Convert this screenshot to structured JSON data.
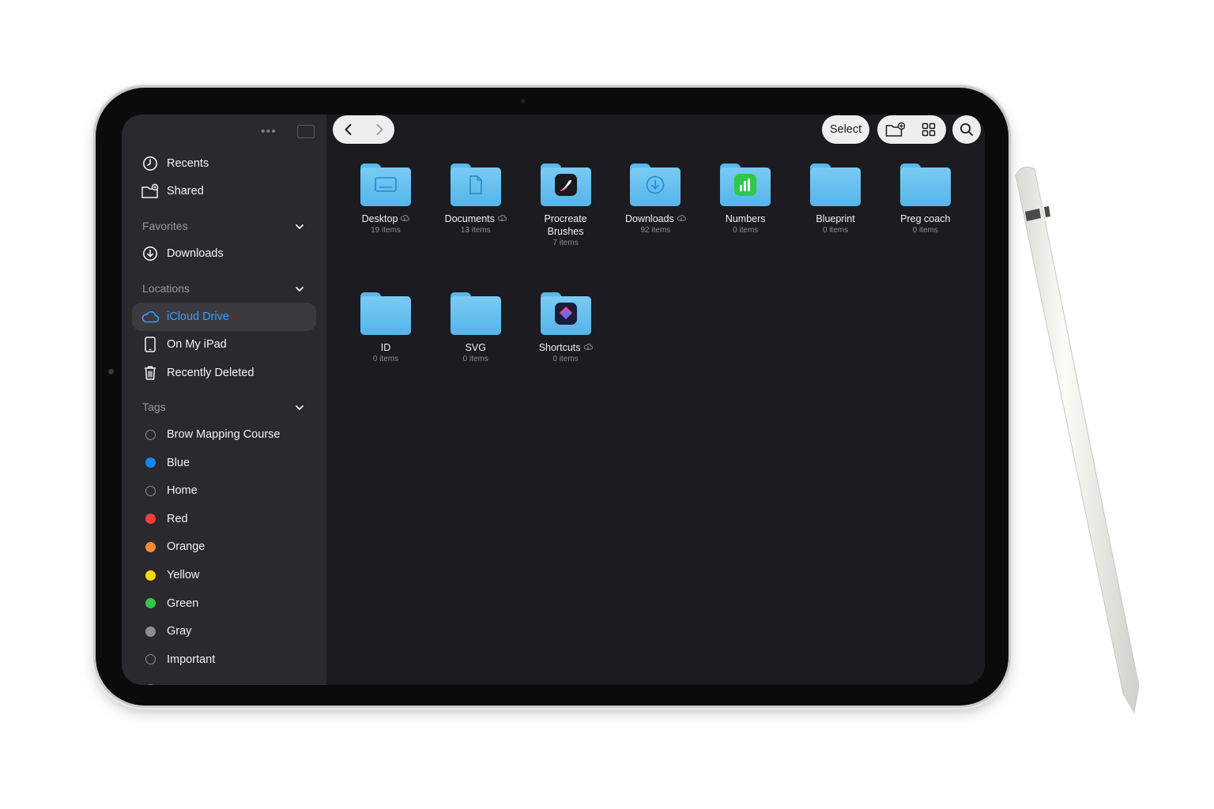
{
  "sidebar": {
    "top_items": [
      {
        "label": "Recents",
        "icon": "clock-icon"
      },
      {
        "label": "Shared",
        "icon": "shared-folder-icon"
      }
    ],
    "favorites": {
      "title": "Favorites",
      "items": [
        {
          "label": "Downloads",
          "icon": "download-circle-icon"
        }
      ]
    },
    "locations": {
      "title": "Locations",
      "items": [
        {
          "label": "iCloud Drive",
          "icon": "cloud-icon",
          "selected": true
        },
        {
          "label": "On My iPad",
          "icon": "ipad-icon"
        },
        {
          "label": "Recently Deleted",
          "icon": "trash-icon"
        }
      ]
    },
    "tags": {
      "title": "Tags",
      "items": [
        {
          "label": "Brow Mapping Course",
          "color": "none"
        },
        {
          "label": "Blue",
          "color": "#1a84ff"
        },
        {
          "label": "Home",
          "color": "none"
        },
        {
          "label": "Red",
          "color": "#ff3b3b"
        },
        {
          "label": "Orange",
          "color": "#ff8a2b"
        },
        {
          "label": "Yellow",
          "color": "#ffd60a"
        },
        {
          "label": "Green",
          "color": "#30c84b"
        },
        {
          "label": "Gray",
          "color": "#8e8e93"
        },
        {
          "label": "Important",
          "color": "none"
        }
      ]
    }
  },
  "toolbar": {
    "select_label": "Select"
  },
  "folders": [
    {
      "name": "Desktop",
      "count": "19 items",
      "cloud": true,
      "icon": "desktop-icon"
    },
    {
      "name": "Documents",
      "count": "13 items",
      "cloud": true,
      "icon": "document-icon"
    },
    {
      "name": "Procreate Brushes",
      "count": "7 items",
      "cloud": false,
      "icon": "procreate-app-icon"
    },
    {
      "name": "Downloads",
      "count": "92 items",
      "cloud": true,
      "icon": "download-circle-icon"
    },
    {
      "name": "Numbers",
      "count": "0 items",
      "cloud": false,
      "icon": "numbers-app-icon"
    },
    {
      "name": "Blueprint",
      "count": "0 items",
      "cloud": false,
      "icon": "none"
    },
    {
      "name": "Preg coach",
      "count": "0 items",
      "cloud": false,
      "icon": "none"
    },
    {
      "name": "ID",
      "count": "0 items",
      "cloud": false,
      "icon": "none"
    },
    {
      "name": "SVG",
      "count": "0 items",
      "cloud": false,
      "icon": "none"
    },
    {
      "name": "Shortcuts",
      "count": "0 items",
      "cloud": true,
      "icon": "shortcuts-app-icon"
    }
  ],
  "colors": {
    "accent": "#3b9bff",
    "folder": "#5ab6eb",
    "sidebar_bg": "#2a292d",
    "main_bg": "#1c1b1f"
  }
}
